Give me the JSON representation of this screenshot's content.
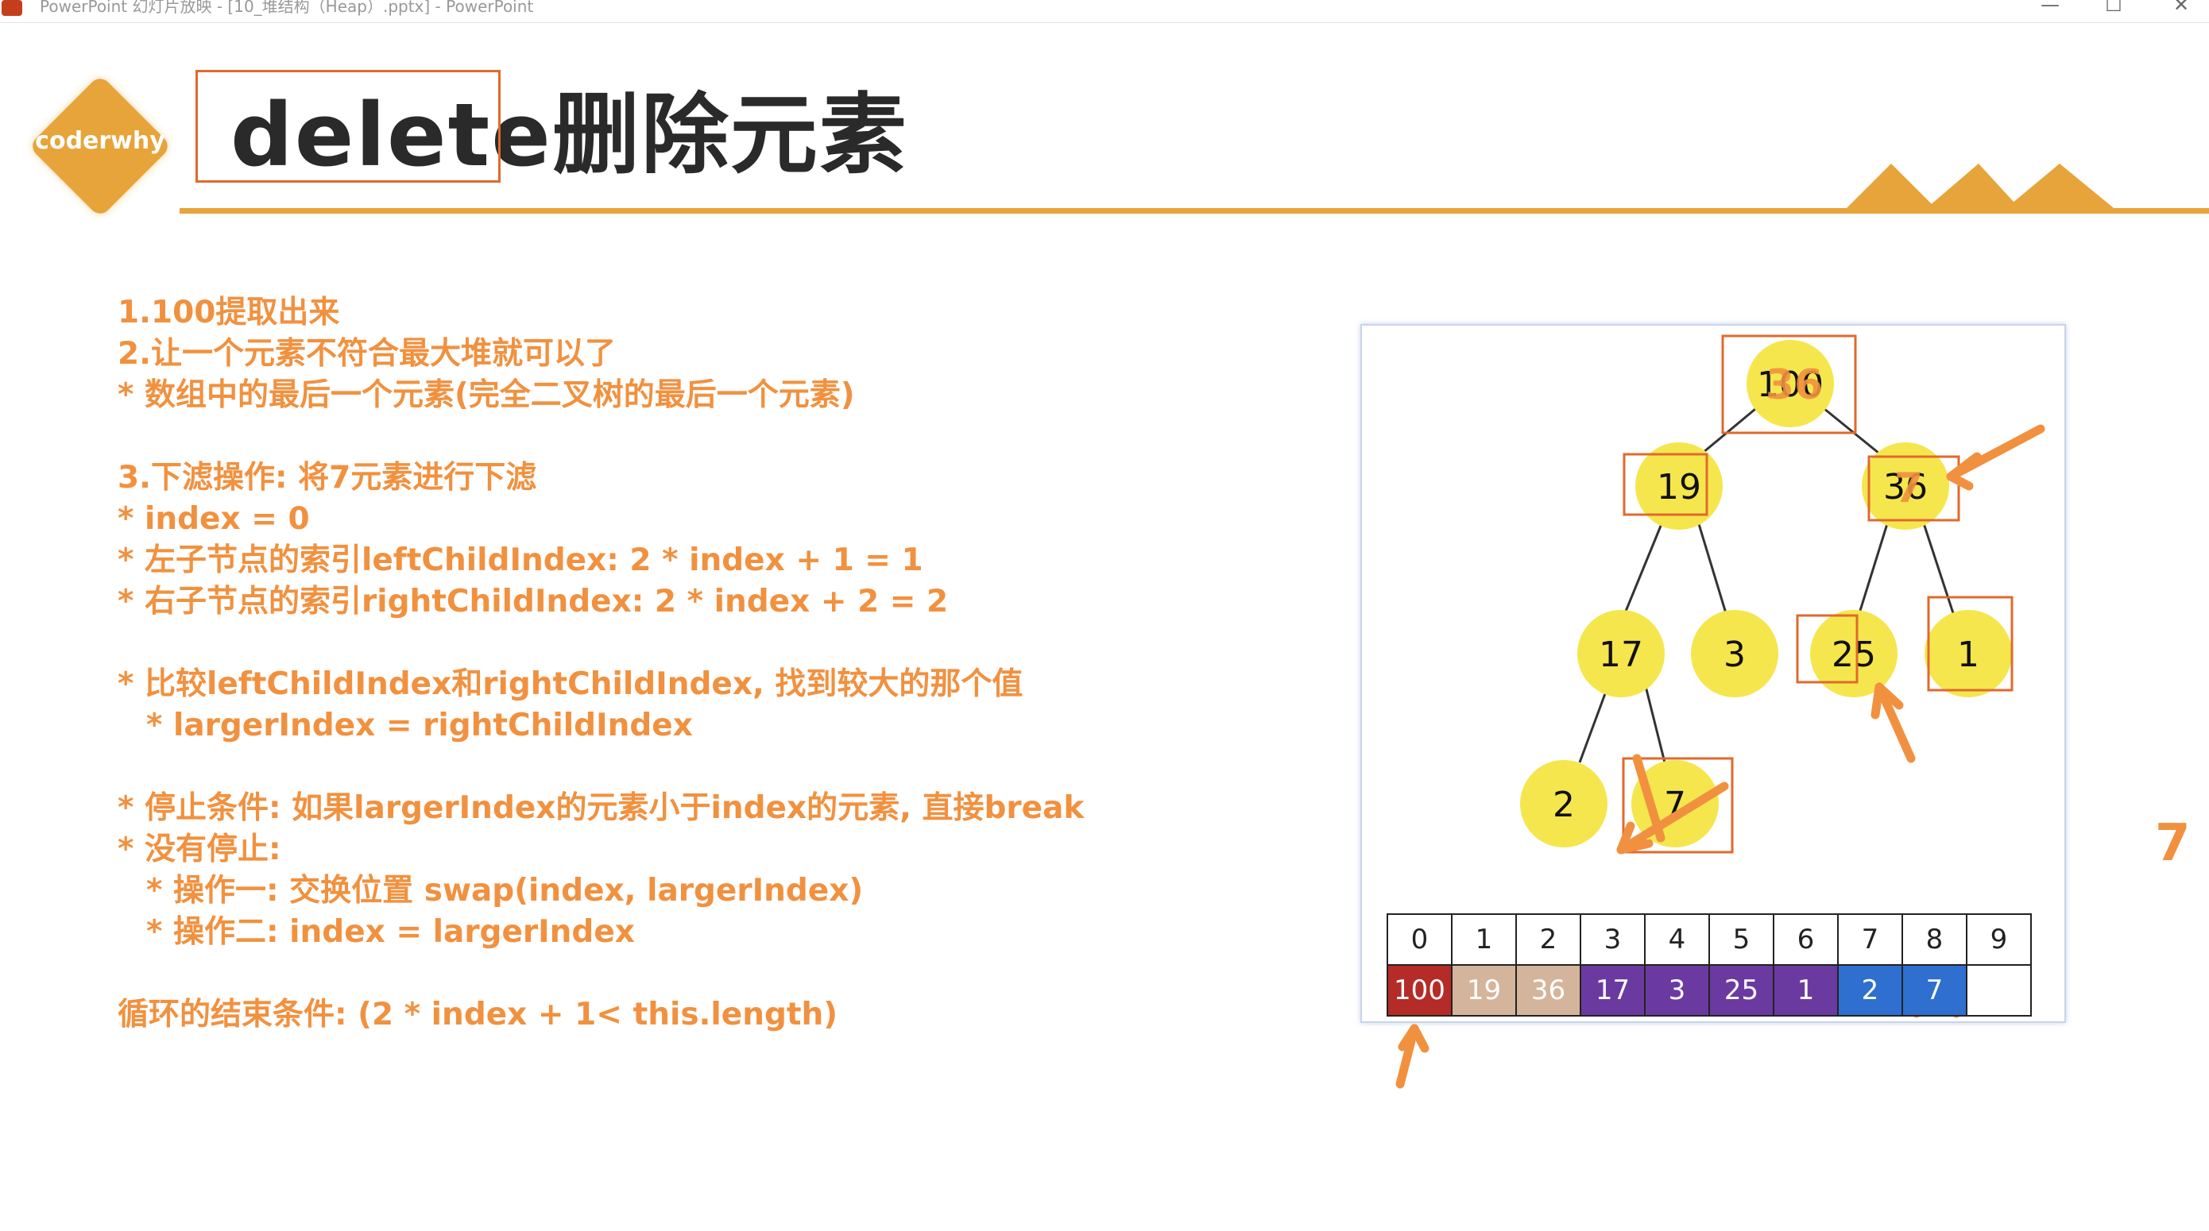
{
  "window": {
    "title": "PowerPoint 幻灯片放映 - [10_堆结构（Heap）.pptx] - PowerPoint",
    "minimize": "—",
    "maximize": "☐",
    "close": "✕"
  },
  "logo": {
    "text": "coderwhy"
  },
  "slide": {
    "title": "delete删除元素",
    "lines": [
      "1.100提取出来",
      "2.让一个元素不符合最大堆就可以了",
      "* 数组中的最后一个元素(完全二叉树的最后一个元素)",
      "3.下滤操作: 将7元素进行下滤",
      "* index = 0",
      "* 左子节点的索引leftChildIndex: 2 * index + 1 = 1",
      "* 右子节点的索引rightChildIndex: 2 * index + 2 = 2",
      "* 比较leftChildIndex和rightChildIndex, 找到较大的那个值",
      "*  largerIndex = rightChildIndex",
      "* 停止条件: 如果largerIndex的元素小于index的元素, 直接break",
      "* 没有停止:",
      "* 操作一: 交换位置 swap(index, largerIndex)",
      "* 操作二: index = largerIndex",
      "循环的结束条件: (2 * index + 1< this.length)"
    ],
    "side_annotation": "7"
  },
  "tree": {
    "nodes": [
      {
        "label": "100",
        "overlay": "36"
      },
      {
        "label": "19",
        "overlay": ""
      },
      {
        "label": "36",
        "overlay": "7"
      },
      {
        "label": "17",
        "overlay": ""
      },
      {
        "label": "3",
        "overlay": ""
      },
      {
        "label": "25",
        "overlay": ""
      },
      {
        "label": "1",
        "overlay": ""
      },
      {
        "label": "2",
        "overlay": ""
      },
      {
        "label": "7",
        "overlay": ""
      }
    ]
  },
  "array": {
    "indices": [
      "0",
      "1",
      "2",
      "3",
      "4",
      "5",
      "6",
      "7",
      "8",
      "9"
    ],
    "values": [
      "100",
      "19",
      "36",
      "17",
      "3",
      "25",
      "1",
      "2",
      "7",
      ""
    ],
    "colors": {
      "root": "#b52b27",
      "level1": "#d4b59b",
      "level2": "#6b3aa0",
      "level3": "#2e6fd0",
      "empty": "#ffffff"
    }
  },
  "colors": {
    "accent": "#e6a43a",
    "annotation": "#f1913f",
    "node_fill": "#f5e64e"
  }
}
